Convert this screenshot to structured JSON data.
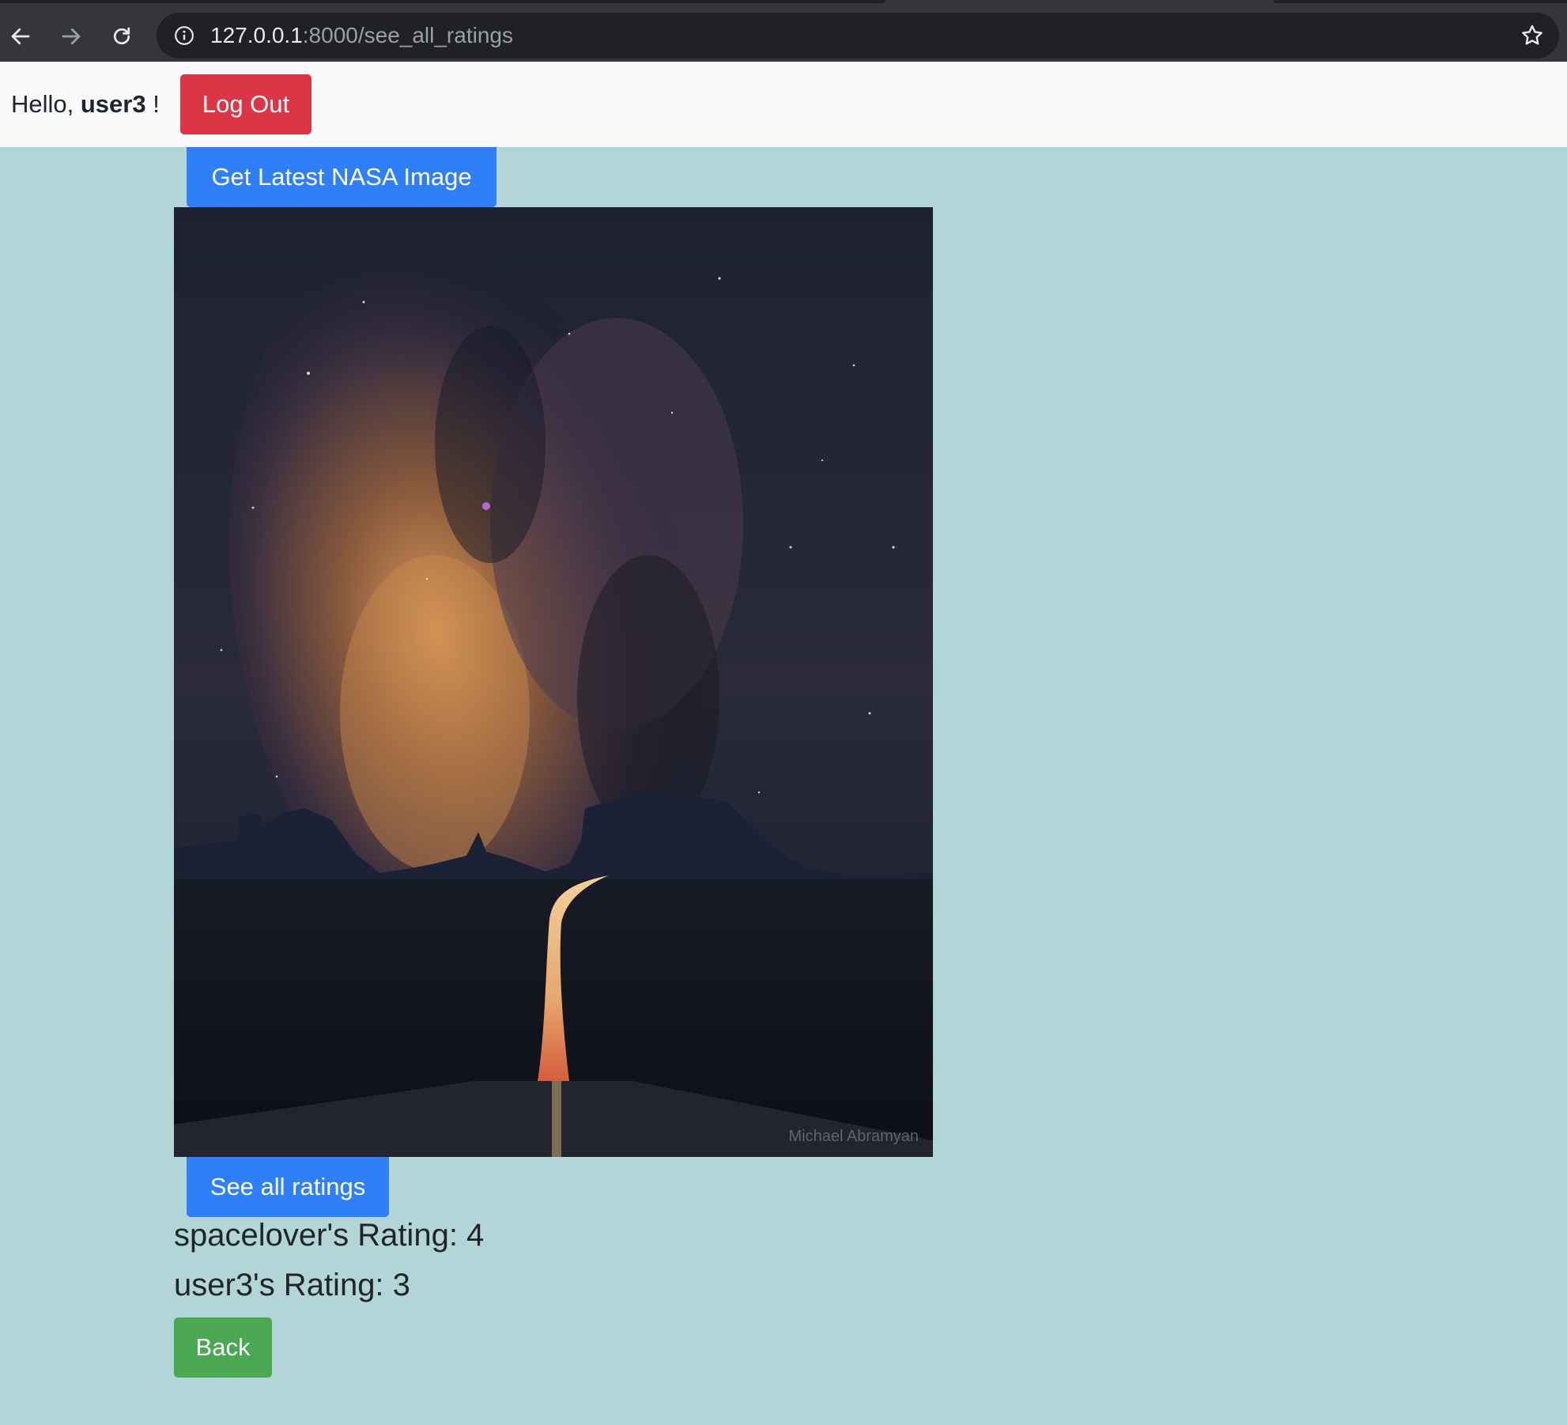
{
  "browser": {
    "url_host": "127.0.0.1",
    "url_rest": ":8000/see_all_ratings"
  },
  "header": {
    "greeting_prefix": "Hello, ",
    "username": "user3",
    "greeting_suffix": " !",
    "logout_label": "Log Out"
  },
  "main": {
    "get_image_label": "Get Latest NASA Image",
    "image": {
      "credit": "Michael Abramyan",
      "description": "Milky Way over desert road"
    },
    "see_ratings_label": "See all ratings",
    "ratings": [
      "spacelover's Rating: 4",
      "user3's Rating: 3"
    ],
    "back_label": "Back"
  },
  "colors": {
    "page_background": "#b2d6d7",
    "header_background": "#f8f9fa",
    "primary": "#2f80f8",
    "danger": "#dc3545",
    "success": "#4aa852"
  },
  "icons": [
    "back-arrow-icon",
    "forward-arrow-icon",
    "reload-icon",
    "info-icon",
    "star-icon"
  ]
}
